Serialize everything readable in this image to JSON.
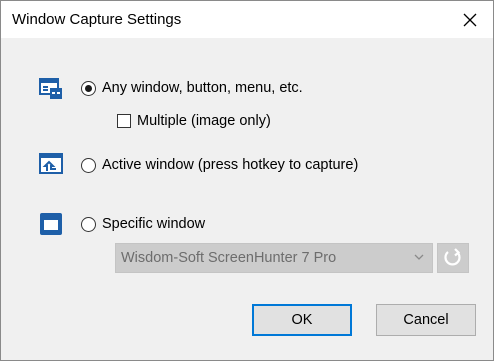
{
  "window": {
    "title": "Window Capture Settings"
  },
  "options": {
    "any": {
      "label": "Any window, button, menu, etc.",
      "checked": true,
      "icon": "window-components-icon"
    },
    "multiple": {
      "label": "Multiple (image only)",
      "checked": false
    },
    "active": {
      "label": "Active window  (press hotkey to capture)",
      "checked": false,
      "icon": "active-window-icon"
    },
    "specific": {
      "label": "Specific window",
      "checked": false,
      "icon": "specific-window-icon"
    }
  },
  "window_select": {
    "value": "Wisdom-Soft ScreenHunter 7 Pro"
  },
  "buttons": {
    "ok": "OK",
    "cancel": "Cancel"
  },
  "colors": {
    "accent": "#0078d7",
    "icon_blue": "#1e5fa8"
  }
}
